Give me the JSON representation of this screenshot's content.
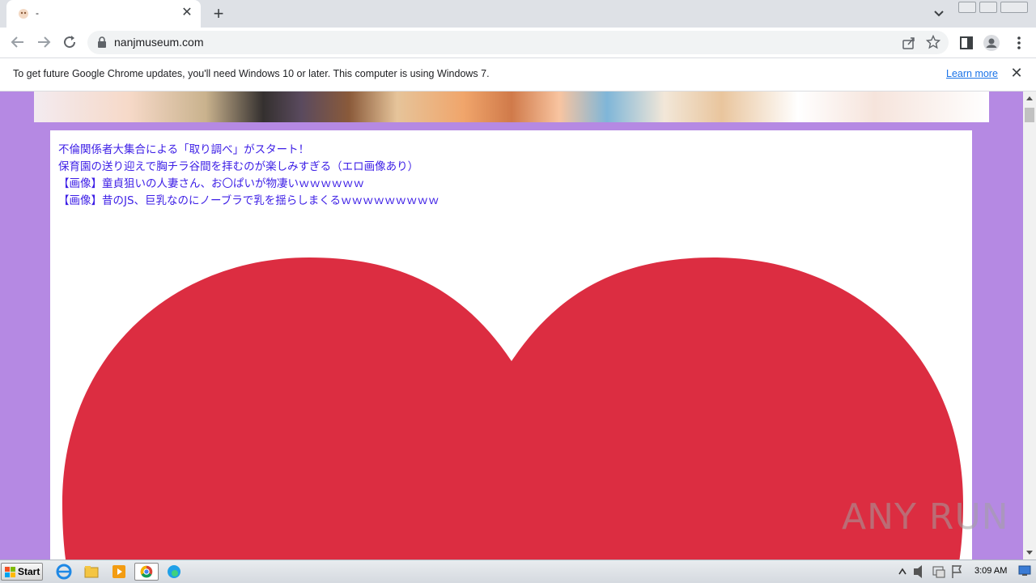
{
  "browser": {
    "tab_title": "-",
    "url": "nanjmuseum.com"
  },
  "infobar": {
    "message": "To get future Google Chrome updates, you'll need Windows 10 or later. This computer is using Windows 7.",
    "learn_more": "Learn more"
  },
  "page": {
    "links": [
      "不倫関係者大集合による「取り調べ」がスタート！",
      "保育園の送り迎えで胸チラ谷間を拝むのが楽しみすぎる（エロ画像あり）",
      "【画像】童貞狙いの人妻さん、お〇ぱいが物凄いｗｗｗｗｗｗ",
      "【画像】昔のJS、巨乳なのにノーブラで乳を揺らしまくるｗｗｗｗｗｗｗｗｗ"
    ],
    "heart_color": "#dc2d41",
    "background_color": "#b589e3"
  },
  "watermark": "ANY RUN",
  "taskbar": {
    "start_label": "Start",
    "clock": "3:09 AM"
  }
}
